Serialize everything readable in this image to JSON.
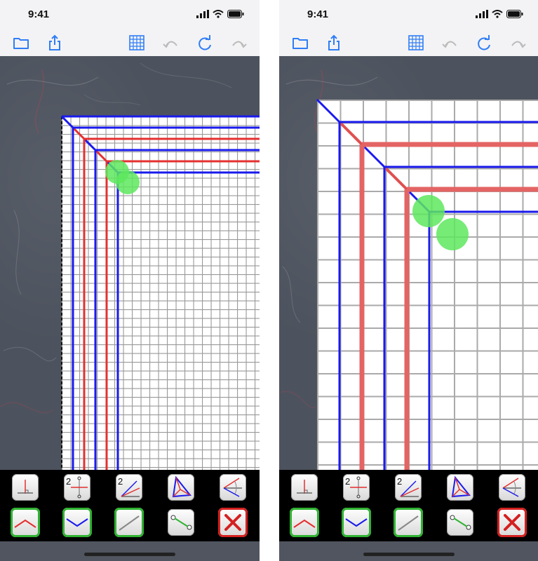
{
  "status": {
    "time": "9:41"
  },
  "colors": {
    "accent": "#2f7df6",
    "blue_line": "#1a1aee",
    "red_line": "#e53030",
    "marker": "#5ee85e",
    "active_border": "#2fb232",
    "close_border": "#d42020"
  },
  "toolbar": {
    "items": [
      {
        "name": "folder-icon",
        "enabled": true
      },
      {
        "name": "share-icon",
        "enabled": true
      },
      {
        "name": "grid-icon",
        "enabled": true
      },
      {
        "name": "undo-icon",
        "enabled": false
      },
      {
        "name": "rotate-icon",
        "enabled": true
      },
      {
        "name": "redo-icon",
        "enabled": false
      }
    ]
  },
  "tools": {
    "row1": [
      {
        "name": "perpendicular-tool",
        "label": ""
      },
      {
        "name": "halve-tool",
        "label": "2"
      },
      {
        "name": "bisect-angle-tool",
        "label": "2"
      },
      {
        "name": "triangle-center-tool",
        "label": ""
      },
      {
        "name": "angle-tool",
        "label": ""
      }
    ],
    "row2": [
      {
        "name": "mountain-fold-tool",
        "state": "active"
      },
      {
        "name": "valley-fold-tool",
        "state": "active"
      },
      {
        "name": "aux-line-tool",
        "state": "active"
      },
      {
        "name": "segment-tool",
        "state": "normal"
      },
      {
        "name": "delete-tool",
        "state": "close"
      }
    ]
  }
}
